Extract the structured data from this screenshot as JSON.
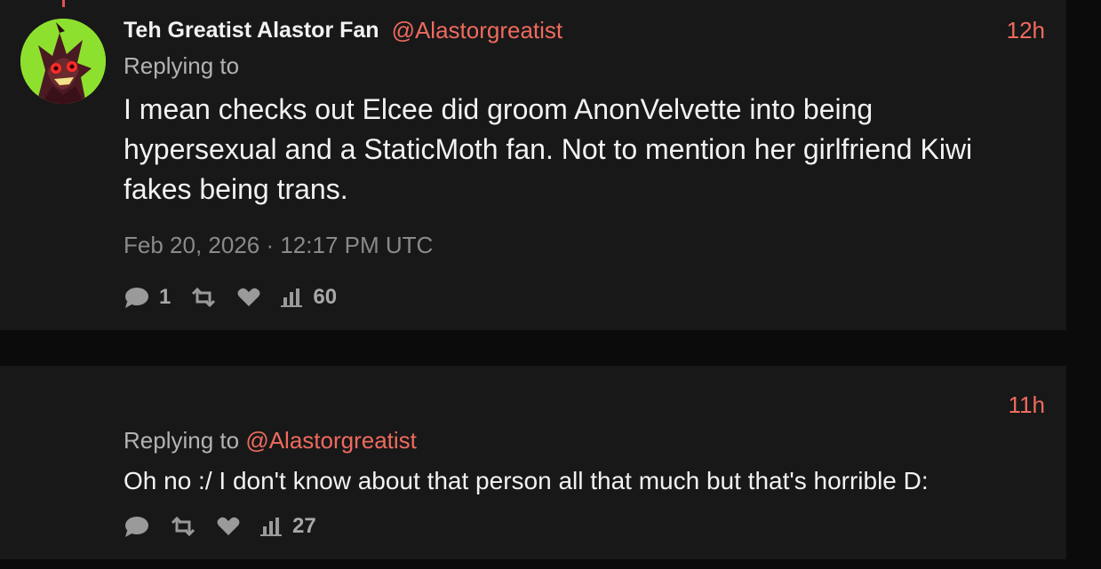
{
  "posts": [
    {
      "author": {
        "display_name": "Teh Greatist Alastor Fan",
        "handle": "@Alastorgreatist",
        "avatar_icon": "alastor-avatar"
      },
      "relative_time": "12h",
      "replying_label": "Replying to",
      "replying_to": "",
      "text": "I mean checks out Elcee did groom AnonVelvette into being hypersexual and a StaticMoth fan. Not to mention her girlfriend Kiwi fakes being trans.",
      "full_timestamp": "Feb 20, 2026 · 12:17 PM UTC",
      "stats": {
        "replies": "1",
        "views": "60"
      }
    },
    {
      "author": {
        "display_name": "",
        "handle": ""
      },
      "relative_time": "11h",
      "replying_label": "Replying to",
      "replying_to": "@Alastorgreatist",
      "text": "Oh no :/ I don't know about that person all that much but that's horrible D:",
      "stats": {
        "views": "27"
      }
    }
  ],
  "colors": {
    "background": "#0b0b0b",
    "card": "#181818",
    "accent": "#ef6a5e",
    "text": "#f2f2f2",
    "muted": "#8a8a8a",
    "avatar_bg": "#8ee02f"
  },
  "icons": {
    "reply": "comment-icon",
    "repost": "repost-icon",
    "like": "heart-icon",
    "views": "bar-chart-icon"
  }
}
